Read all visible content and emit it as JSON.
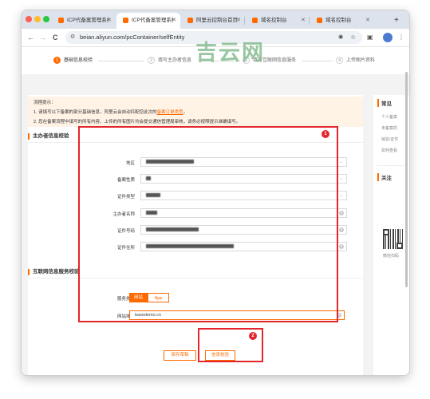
{
  "browser": {
    "tabs": [
      {
        "title": "ICP代备案管理系统"
      },
      {
        "title": "ICP代备案管理系统"
      },
      {
        "title": "阿里云控制台首页"
      },
      {
        "title": "域名控制台"
      },
      {
        "title": "域名控制台"
      }
    ],
    "new_tab": "+",
    "url": "beian.aliyun.com/pcContainer/selfEntity",
    "nav": {
      "back": "←",
      "forward": "→",
      "reload": "C"
    }
  },
  "watermark": "吉云网",
  "steps": [
    {
      "num": "1",
      "label": "基础信息校验",
      "active": true
    },
    {
      "num": "2",
      "label": "填写主办者信息",
      "active": false
    },
    {
      "num": "3",
      "label": "填写互联网信息服务",
      "active": false
    },
    {
      "num": "4",
      "label": "上传图片资料",
      "active": false
    }
  ],
  "tips": {
    "heading": "流程提示：",
    "line1_prefix": "1. 请填写以下备案的部分基础信息，阿里云会自动匹配您此次的",
    "line1_link": "备案订单类型",
    "line1_suffix": "。",
    "line2": "2. 您在备案流程中填写的所有内容、上传的所有图片均会提交通信管理局审核，请务必按照提示准确填写。"
  },
  "sponsor_section": {
    "title": "主办者信息校验",
    "fields": [
      {
        "label": "地区",
        "value": "",
        "type": "select"
      },
      {
        "label": "备案性质",
        "value": "",
        "type": "select"
      },
      {
        "label": "证件类型",
        "value": "",
        "type": "select"
      },
      {
        "label": "主办者名称",
        "value": "",
        "type": "input"
      },
      {
        "label": "证件号码",
        "value": "",
        "type": "input"
      },
      {
        "label": "证件住所",
        "value": "",
        "type": "input"
      }
    ]
  },
  "service_section": {
    "title": "互联网信息服务校验",
    "service_type_label": "服务类型",
    "service_type_options": [
      "网站",
      "App"
    ],
    "domain_label": "网站域名",
    "domain_value": "basedemo.cn"
  },
  "buttons": {
    "save": "保存草稿",
    "verify": "信息校验"
  },
  "sidebar": {
    "faq_title": "常见",
    "faq_items": [
      "个人备案",
      "未备案的",
      "域名/证件",
      "如何查看"
    ],
    "follow_title": "关注",
    "qr_caption": "微信扫码"
  },
  "annotations": [
    "1",
    "2"
  ],
  "colors": {
    "accent": "#ff6a00",
    "highlight": "#e3262b",
    "tips_bg": "#fff3e6"
  }
}
